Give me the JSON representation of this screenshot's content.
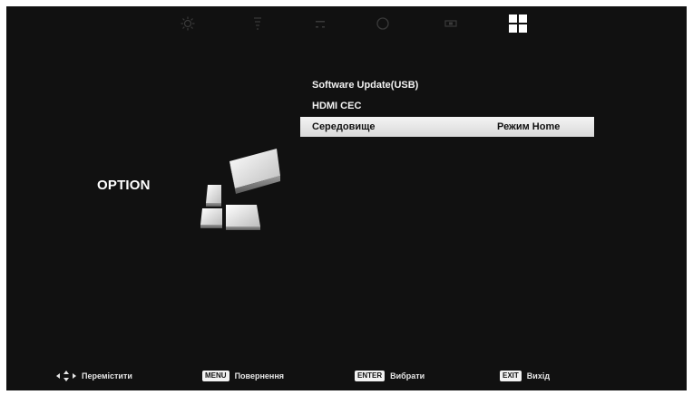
{
  "topbar": {
    "tabs": [
      {
        "name": "picture-settings-icon"
      },
      {
        "name": "sound-settings-icon"
      },
      {
        "name": "channel-settings-icon"
      },
      {
        "name": "time-settings-icon"
      },
      {
        "name": "lock-settings-icon"
      },
      {
        "name": "option-tiles-icon",
        "active": true
      }
    ]
  },
  "section": {
    "title": "OPTION"
  },
  "menu": {
    "items": [
      {
        "label": "Software Update(USB)",
        "value": ""
      },
      {
        "label": "HDMI CEC",
        "value": ""
      },
      {
        "label": "Середовище",
        "value": "Режим Home",
        "selected": true
      }
    ]
  },
  "footer": {
    "move_label": "Перемістити",
    "menu_key": "MENU",
    "menu_label": "Повернення",
    "enter_key": "ENTER",
    "enter_label": "Вибрати",
    "exit_key": "EXIT",
    "exit_label": "Вихід"
  },
  "colors": {
    "background": "#111111",
    "text": "#f2f2f2",
    "selection": "#e6e6e6",
    "inactive_icon": "#3a3a3a"
  }
}
